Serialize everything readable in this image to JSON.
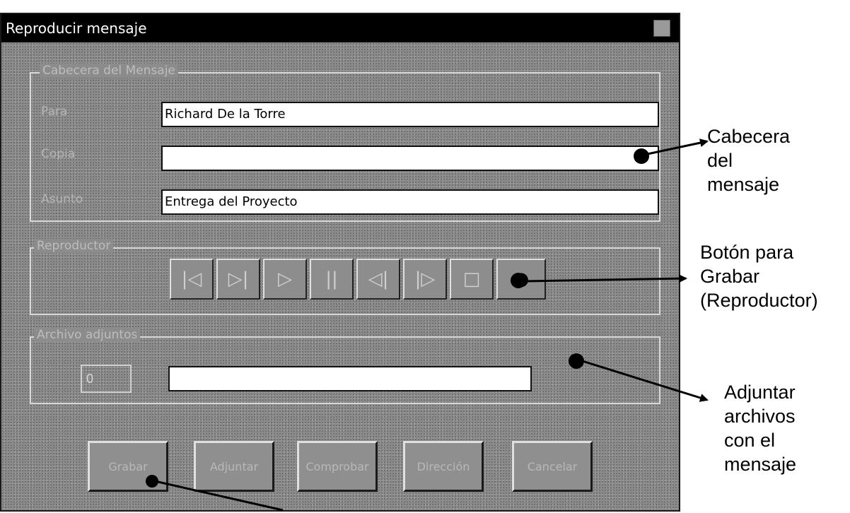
{
  "window": {
    "title": "Reproducir mensaje"
  },
  "header_group": {
    "legend": "Cabecera del Mensaje",
    "para_label": "Para",
    "para_value": "Richard De la Torre",
    "copia_label": "Copia",
    "copia_value": "",
    "asunto_label": "Asunto",
    "asunto_value": "Entrega del Proyecto"
  },
  "player_group": {
    "legend": "Reproductor",
    "buttons": [
      {
        "icon": "skip-to-start-icon",
        "glyph": "|◁"
      },
      {
        "icon": "skip-to-end-icon",
        "glyph": "▷|"
      },
      {
        "icon": "play-icon",
        "glyph": "▷"
      },
      {
        "icon": "pause-icon",
        "glyph": "||"
      },
      {
        "icon": "step-back-icon",
        "glyph": "◁|"
      },
      {
        "icon": "step-forward-icon",
        "glyph": "|▷"
      },
      {
        "icon": "stop-icon",
        "glyph": "□"
      },
      {
        "icon": "record-icon",
        "glyph": "●"
      }
    ]
  },
  "attach_group": {
    "legend": "Archivo adjuntos",
    "count_value": "0",
    "file_value": ""
  },
  "status_text": "",
  "buttons": {
    "grabar": "Grabar",
    "adjuntar": "Adjuntar",
    "comprobar": "Comprobar",
    "direccion": "Dirección",
    "cancelar": "Cancelar"
  },
  "annotations": {
    "cabecera": [
      "Cabecera",
      "del",
      "mensaje"
    ],
    "grabar": [
      "Botón para",
      "Grabar",
      "(Reproductor)"
    ],
    "adjuntar": [
      "Adjuntar",
      "archivos",
      "con el",
      "mensaje"
    ]
  },
  "colors": {
    "window_bg": "#8a8a8a",
    "titlebar": "#000000",
    "field_bg": "#ffffff"
  }
}
